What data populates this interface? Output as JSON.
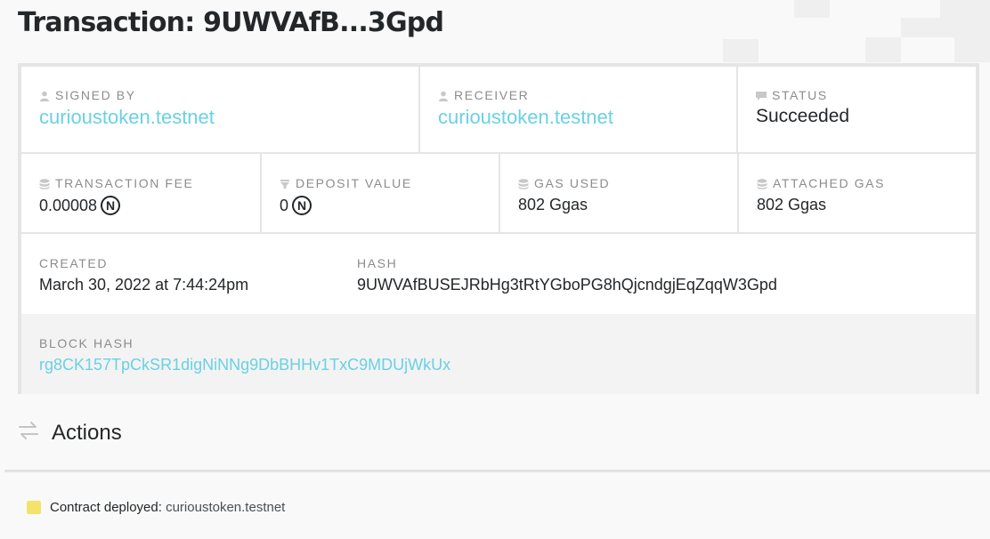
{
  "page": {
    "title": "Transaction: 9UWVAfB...3Gpd"
  },
  "transaction": {
    "signed_by_label": "SIGNED BY",
    "signed_by": "curioustoken.testnet",
    "receiver_label": "RECEIVER",
    "receiver": "curioustoken.testnet",
    "status_label": "STATUS",
    "status": "Succeeded",
    "fee_label": "TRANSACTION FEE",
    "fee": "0.00008",
    "deposit_label": "DEPOSIT VALUE",
    "deposit": "0",
    "gas_used_label": "GAS USED",
    "gas_used": "802 Ggas",
    "attached_gas_label": "ATTACHED GAS",
    "attached_gas": "802 Ggas",
    "created_label": "CREATED",
    "created": "March 30, 2022 at 7:44:24pm",
    "hash_label": "HASH",
    "hash": "9UWVAfBUSEJRbHg3tRtYGboPG8hQjcndgjEqZqqW3Gpd",
    "block_hash_label": "BLOCK HASH",
    "block_hash": "rg8CK157TpCkSR1digNiNNg9DbBHHv1TxC9MDUjWkUx",
    "near_symbol": "N"
  },
  "actions": {
    "title": "Actions",
    "items": [
      {
        "label": "Contract deployed:",
        "target": "curioustoken.testnet"
      }
    ]
  },
  "icons": {
    "user": "user-icon",
    "status": "message-icon",
    "fee": "database-icon",
    "deposit": "filter-icon",
    "actions": "exchange-arrows-icon",
    "action": "deploy-file-icon"
  },
  "colors": {
    "link": "#6ad1e3",
    "label": "#8c8c8c",
    "border": "#e5e5e5",
    "action_icon": "#f2e36b"
  }
}
